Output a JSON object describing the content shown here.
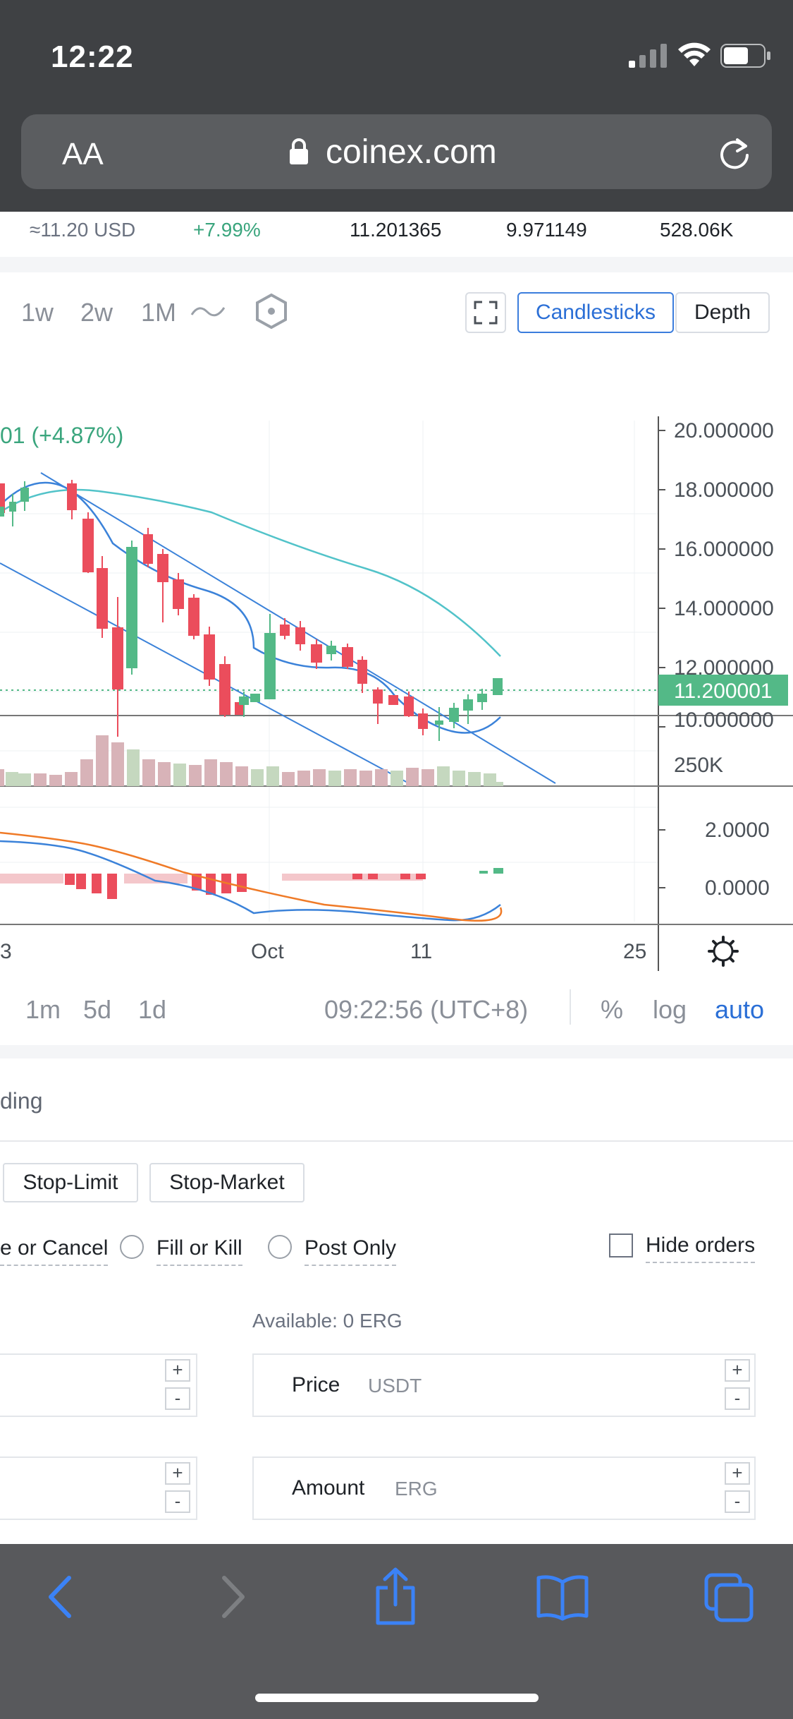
{
  "status_bar": {
    "time": "12:22"
  },
  "browser": {
    "text_size_label": "AA",
    "url": "coinex.com"
  },
  "ticker": {
    "usd_price": "≈11.20 USD",
    "change": "+7.99%",
    "high": "11.201365",
    "low": "9.971149",
    "volume": "528.06K"
  },
  "chart": {
    "timeframes": [
      "1w",
      "2w",
      "1M"
    ],
    "view_tabs": {
      "candlesticks": "Candlesticks",
      "depth": "Depth"
    },
    "change_label": "01 (+4.87%)",
    "price_axis": [
      "20.000000",
      "18.000000",
      "16.000000",
      "14.000000",
      "12.000000",
      "10.000000"
    ],
    "current_price": "11.200001",
    "volume_axis": "250K",
    "macd_axis": [
      "2.0000",
      "0.0000"
    ],
    "time_axis": [
      "3",
      "Oct",
      "11",
      "25"
    ],
    "range_buttons": [
      "1m",
      "5d",
      "1d"
    ],
    "clock": "09:22:56 (UTC+8)",
    "scale_options": {
      "percent": "%",
      "log": "log",
      "auto": "auto"
    },
    "colors": {
      "up": "#53b987",
      "down": "#eb4d5c",
      "line_blue": "#3b82d9",
      "line_teal": "#52c3c9",
      "macd_orange": "#ef7a27",
      "accent": "#2b6fd6"
    }
  },
  "trading": {
    "title": "ding",
    "order_types": [
      "Stop-Limit",
      "Stop-Market"
    ],
    "options": [
      "e or Cancel",
      "Fill or Kill",
      "Post Only"
    ],
    "hide_orders": "Hide orders",
    "available": "Available: 0 ERG",
    "price_field": {
      "label": "Price",
      "unit": "USDT"
    },
    "amount_field": {
      "label": "Amount",
      "unit": "ERG"
    },
    "stepper": {
      "plus": "+",
      "minus": "-"
    }
  }
}
